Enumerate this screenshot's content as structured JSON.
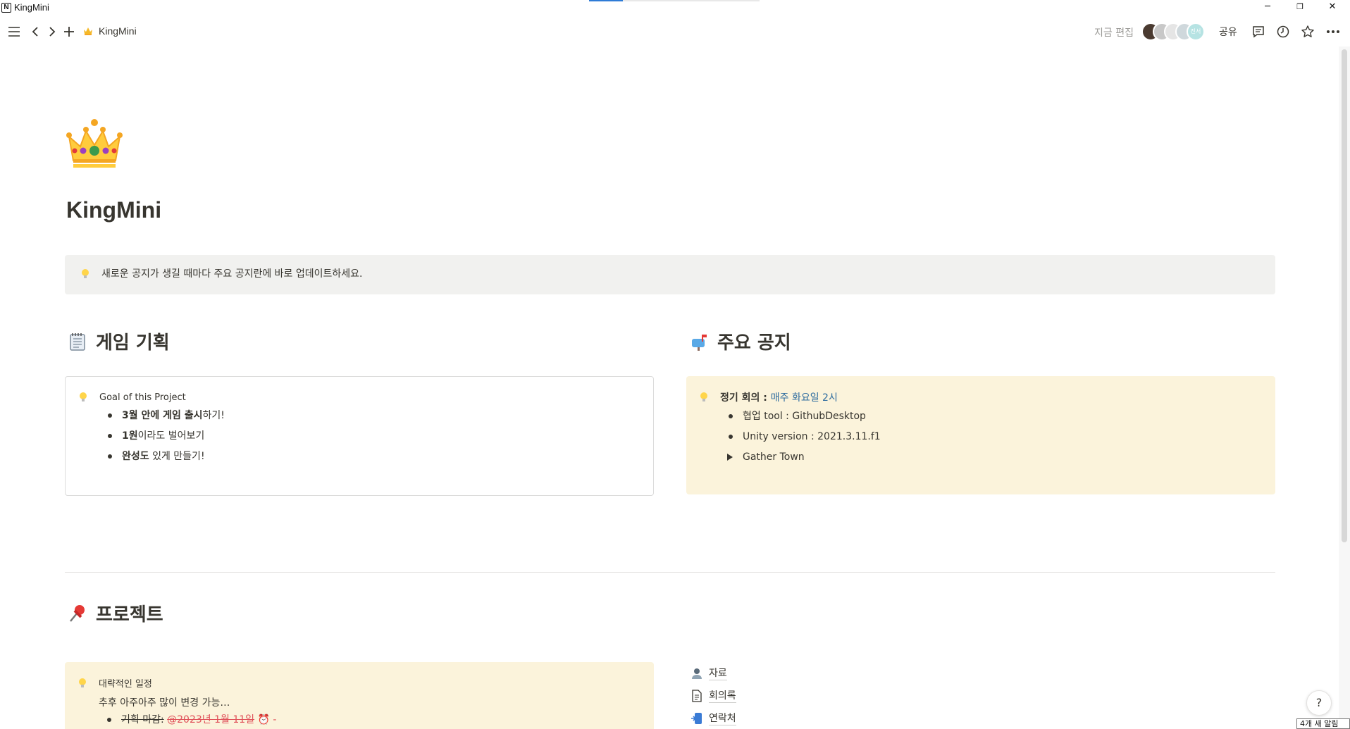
{
  "window": {
    "title": "KingMini",
    "app_icon_letter": "N",
    "minimize": "─",
    "restore": "❐",
    "close": "✕"
  },
  "toolbar": {
    "breadcrumb": "KingMini",
    "editing_label": "지금 편집",
    "share_label": "공유",
    "avatar_badge": "진서"
  },
  "page": {
    "title": "KingMini",
    "icon": "crown-emoji"
  },
  "notice_callout": {
    "text": "새로운 공지가 생길 때마다 주요 공지란에 바로 업데이트하세요."
  },
  "section_game": {
    "heading": "게임 기획",
    "callout_title": "Goal of this Project",
    "items": [
      {
        "bold": "3월 안에 게임 출시",
        "rest": "하기!"
      },
      {
        "bold": "1원",
        "rest": "이라도 벌어보기"
      },
      {
        "bold": "완성도",
        "rest": " 있게 만들기!"
      }
    ]
  },
  "section_notice": {
    "heading": "주요 공지",
    "meeting_label": "정기 회의 : ",
    "meeting_value": "매주 화요일 2시",
    "items": [
      "협업 tool : GithubDesktop",
      "Unity version : 2021.3.11.f1"
    ],
    "toggle_item": "Gather Town"
  },
  "section_project": {
    "heading": "프로젝트",
    "callout_title": "대략적인 일정",
    "callout_sub": "추후 아주아주 많이 변경 가능…",
    "first_item_label": "기획 마감:",
    "first_item_date": "@2023년 1월 11일",
    "first_item_tail": "-",
    "links": [
      {
        "label": "자료",
        "icon": "person-icon"
      },
      {
        "label": "회의록",
        "icon": "document-icon"
      },
      {
        "label": "연락처",
        "icon": "phone-icon"
      }
    ]
  },
  "help_label": "?",
  "notification": "4개 새 알림",
  "colors": {
    "callout_gray": "#f1f1ef",
    "callout_yellow": "#fbf3db",
    "link_blue": "#2b6a9e",
    "strike_red": "#e0525a"
  }
}
